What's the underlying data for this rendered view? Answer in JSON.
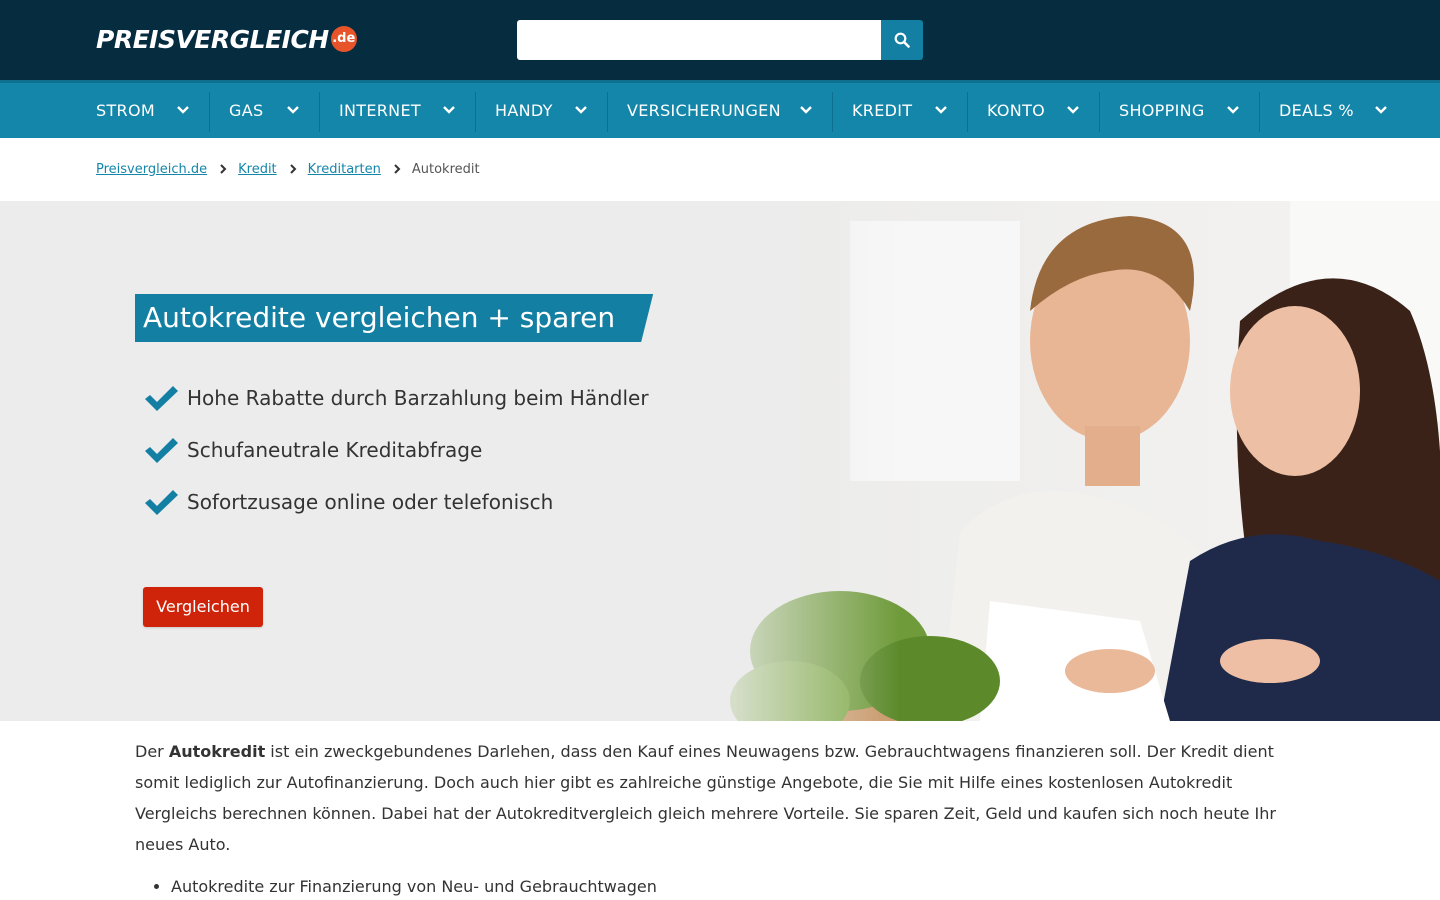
{
  "header": {
    "logo_text": "PREISVERGLEICH",
    "logo_badge": ".de",
    "search": {
      "placeholder": "",
      "value": ""
    },
    "search_icon": "search-icon"
  },
  "nav": {
    "items": [
      {
        "label": "STROM"
      },
      {
        "label": "GAS"
      },
      {
        "label": "INTERNET"
      },
      {
        "label": "HANDY"
      },
      {
        "label": "VERSICHERUNGEN"
      },
      {
        "label": "KREDIT"
      },
      {
        "label": "KONTO"
      },
      {
        "label": "SHOPPING"
      },
      {
        "label": "DEALS %"
      }
    ],
    "chevron_icon": "chevron-down-icon"
  },
  "breadcrumb": {
    "items": [
      {
        "label": "Preisvergleich.de"
      },
      {
        "label": "Kredit"
      },
      {
        "label": "Kreditarten"
      }
    ],
    "current": "Autokredit"
  },
  "hero": {
    "title": "Autokredite vergleichen + sparen",
    "usps": [
      "Hohe Rabatte durch Barzahlung beim Händler",
      "Schufaneutrale Kreditabfrage",
      "Sofortzusage online oder telefonisch"
    ],
    "cta_label": "Vergleichen",
    "image": "couple-reviewing-documents-photo"
  },
  "content": {
    "intro_prefix": "Der ",
    "intro_bold": "Autokredit",
    "intro_rest": " ist ein zweckgebundenes Darlehen, dass den Kauf eines Neuwagens bzw. Gebrauchtwagens finanzieren soll. Der Kredit dient somit lediglich zur Autofinanzierung. Doch auch hier gibt es zahlreiche günstige Angebote, die Sie mit Hilfe eines kostenlosen Autokredit Vergleichs berechnen können. Dabei hat der Autokreditvergleich gleich mehrere Vorteile. Sie sparen Zeit, Geld und kaufen sich noch heute Ihr neues Auto.",
    "bullets": [
      "Autokredite zur Finanzierung von Neu- und Gebrauchtwagen"
    ]
  },
  "colors": {
    "header_bg": "#062c40",
    "nav_bg": "#1486aa",
    "accent": "#137fa3",
    "cta": "#d0240a",
    "logo_badge": "#e8542a"
  }
}
